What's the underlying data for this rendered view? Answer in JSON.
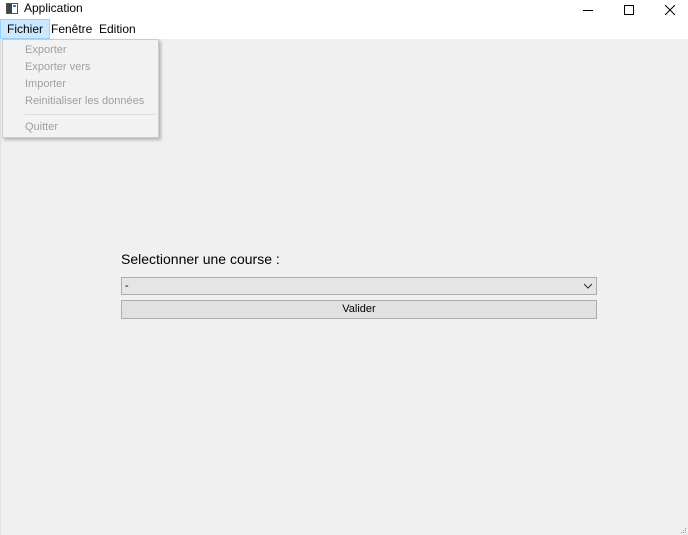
{
  "window": {
    "title": "Application",
    "app_icon": "window-icon",
    "controls": [
      "minimize-icon",
      "maximize-icon",
      "close-icon"
    ]
  },
  "menubar": {
    "items": [
      {
        "label": "Fichier",
        "active": true
      },
      {
        "label": "Fenêtre",
        "active": false
      },
      {
        "label": "Edition",
        "active": false
      }
    ]
  },
  "fichier_menu": {
    "items": [
      {
        "label": "Exporter",
        "enabled": false
      },
      {
        "label": "Exporter vers",
        "enabled": false
      },
      {
        "label": "Importer",
        "enabled": false
      },
      {
        "label": "Reinitialiser les données",
        "enabled": false
      },
      {
        "label": "Quitter",
        "enabled": false
      }
    ]
  },
  "main": {
    "label": "Selectionner une course :",
    "combo_value": "-",
    "combo_icon": "chevron-down-icon",
    "validate_label": "Valider"
  },
  "colors": {
    "background": "#f0f0f0",
    "menu_active_bg": "#cce8ff",
    "menu_active_border": "#99d1ff",
    "disabled_text": "#a0a0a0"
  }
}
